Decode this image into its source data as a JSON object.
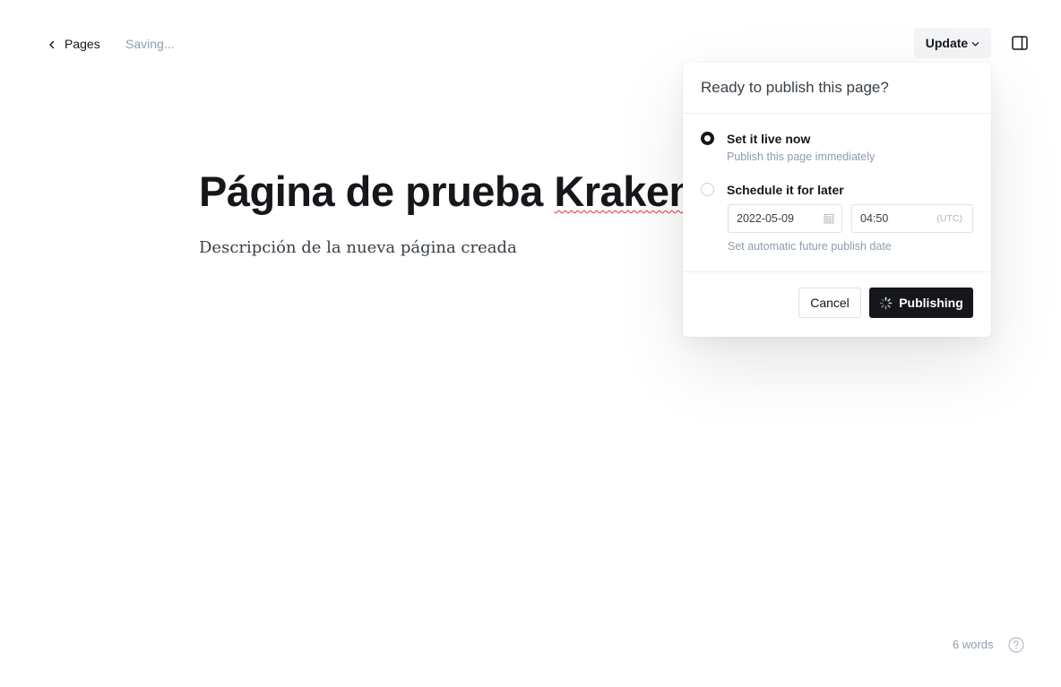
{
  "topbar": {
    "back_label": "Pages",
    "status": "Saving...",
    "update_label": "Update"
  },
  "editor": {
    "title_main": "Página de prueba ",
    "title_flagged_word": "Kraken",
    "excerpt": "Descripción de la nueva página creada"
  },
  "publish_menu": {
    "heading": "Ready to publish this page?",
    "option_now": {
      "label": "Set it live now",
      "description": "Publish this page immediately",
      "selected": true
    },
    "option_schedule": {
      "label": "Schedule it for later",
      "selected": false,
      "date": "2022-05-09",
      "time": "04:50",
      "timezone": "(UTC)",
      "hint": "Set automatic future publish date"
    },
    "cancel_label": "Cancel",
    "publish_label": "Publishing"
  },
  "footer": {
    "word_count": "6 words"
  },
  "icons": {
    "back": "chevron-left-icon",
    "update_caret": "chevron-down-icon",
    "sidebar": "sidebar-toggle-icon",
    "calendar": "calendar-icon",
    "spinner": "spinner-icon",
    "help": "help-icon"
  },
  "colors": {
    "text": "#15171a",
    "muted": "#8e9cac",
    "primary_button": "#15171a",
    "spellcheck": "#e0303a"
  }
}
